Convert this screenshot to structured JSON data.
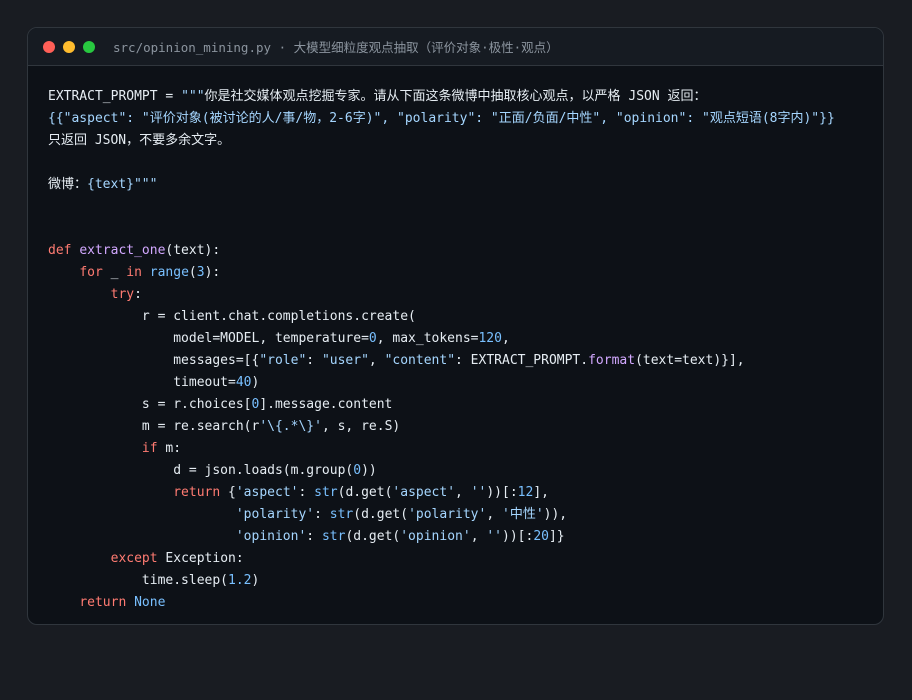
{
  "window": {
    "controls": [
      "close",
      "minimize",
      "maximize"
    ],
    "title": "src/opinion_mining.py · 大模型细粒度观点抽取（评价对象·极性·观点）"
  },
  "code": {
    "lines": [
      [
        [
          "tx",
          "EXTRACT_PROMPT = "
        ],
        [
          "st",
          "\"\"\""
        ],
        [
          "tx",
          "你是社交媒体观点挖掘专家。请从下面这条微博中抽取核心观点，以严格 JSON 返回："
        ]
      ],
      [
        [
          "st",
          "{{\"aspect\": \"评价对象(被讨论的人/事/物，2-6字)\", \"polarity\": \"正面/负面/中性\", \"opinion\": \"观点短语(8字内)\"}}"
        ]
      ],
      [
        [
          "tx",
          "只返回 JSON，不要多余文字。"
        ]
      ],
      [],
      [
        [
          "tx",
          "微博："
        ],
        [
          "st",
          "{text}\"\"\""
        ]
      ],
      [],
      [],
      [
        [
          "kw",
          "def "
        ],
        [
          "fn",
          "extract_one"
        ],
        [
          "tx",
          "(text):"
        ]
      ],
      [
        [
          "tx",
          "    "
        ],
        [
          "kw",
          "for"
        ],
        [
          "tx",
          " _ "
        ],
        [
          "kw",
          "in "
        ],
        [
          "bi",
          "range"
        ],
        [
          "tx",
          "("
        ],
        [
          "nm",
          "3"
        ],
        [
          "tx",
          "):"
        ]
      ],
      [
        [
          "tx",
          "        "
        ],
        [
          "kw",
          "try"
        ],
        [
          "tx",
          ":"
        ]
      ],
      [
        [
          "tx",
          "            r = client.chat.completions.create("
        ]
      ],
      [
        [
          "tx",
          "                model=MODEL, temperature="
        ],
        [
          "nm",
          "0"
        ],
        [
          "tx",
          ", max_tokens="
        ],
        [
          "nm",
          "120"
        ],
        [
          "tx",
          ","
        ]
      ],
      [
        [
          "tx",
          "                messages=[{"
        ],
        [
          "st",
          "\"role\""
        ],
        [
          "tx",
          ": "
        ],
        [
          "st",
          "\"user\""
        ],
        [
          "tx",
          ", "
        ],
        [
          "st",
          "\"content\""
        ],
        [
          "tx",
          ": EXTRACT_PROMPT."
        ],
        [
          "fn",
          "format"
        ],
        [
          "tx",
          "(text=text)}],"
        ]
      ],
      [
        [
          "tx",
          "                timeout="
        ],
        [
          "nm",
          "40"
        ],
        [
          "tx",
          ")"
        ]
      ],
      [
        [
          "tx",
          "            s = r.choices["
        ],
        [
          "nm",
          "0"
        ],
        [
          "tx",
          "].message.content"
        ]
      ],
      [
        [
          "tx",
          "            m = re.search(r"
        ],
        [
          "st",
          "'\\{.*\\}'"
        ],
        [
          "tx",
          ", s, re.S)"
        ]
      ],
      [
        [
          "tx",
          "            "
        ],
        [
          "kw",
          "if"
        ],
        [
          "tx",
          " m:"
        ]
      ],
      [
        [
          "tx",
          "                d = json.loads(m.group("
        ],
        [
          "nm",
          "0"
        ],
        [
          "tx",
          "))"
        ]
      ],
      [
        [
          "tx",
          "                "
        ],
        [
          "kw",
          "return"
        ],
        [
          "tx",
          " {"
        ],
        [
          "st",
          "'aspect'"
        ],
        [
          "tx",
          ": "
        ],
        [
          "bi",
          "str"
        ],
        [
          "tx",
          "(d.get("
        ],
        [
          "st",
          "'aspect'"
        ],
        [
          "tx",
          ", "
        ],
        [
          "st",
          "''"
        ],
        [
          "tx",
          "))[:"
        ],
        [
          "nm",
          "12"
        ],
        [
          "tx",
          "],"
        ]
      ],
      [
        [
          "tx",
          "                        "
        ],
        [
          "st",
          "'polarity'"
        ],
        [
          "tx",
          ": "
        ],
        [
          "bi",
          "str"
        ],
        [
          "tx",
          "(d.get("
        ],
        [
          "st",
          "'polarity'"
        ],
        [
          "tx",
          ", "
        ],
        [
          "st",
          "'中性'"
        ],
        [
          "tx",
          ")),"
        ]
      ],
      [
        [
          "tx",
          "                        "
        ],
        [
          "st",
          "'opinion'"
        ],
        [
          "tx",
          ": "
        ],
        [
          "bi",
          "str"
        ],
        [
          "tx",
          "(d.get("
        ],
        [
          "st",
          "'opinion'"
        ],
        [
          "tx",
          ", "
        ],
        [
          "st",
          "''"
        ],
        [
          "tx",
          "))[:"
        ],
        [
          "nm",
          "20"
        ],
        [
          "tx",
          "]}"
        ]
      ],
      [
        [
          "tx",
          "        "
        ],
        [
          "kw",
          "except"
        ],
        [
          "tx",
          " Exception:"
        ]
      ],
      [
        [
          "tx",
          "            time.sleep("
        ],
        [
          "nm",
          "1.2"
        ],
        [
          "tx",
          ")"
        ]
      ],
      [
        [
          "tx",
          "    "
        ],
        [
          "kw",
          "return"
        ],
        [
          "tx",
          " "
        ],
        [
          "bi",
          "None"
        ]
      ]
    ]
  }
}
